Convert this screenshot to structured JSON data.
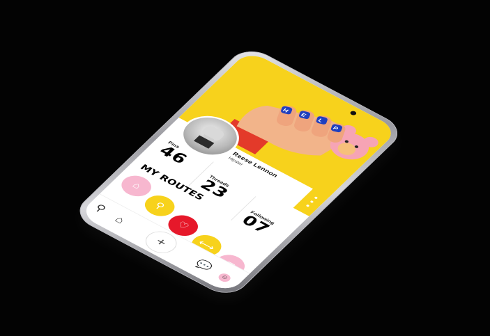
{
  "profile": {
    "name": "Reese Lennon",
    "handle": "Hipster"
  },
  "nail_letters": [
    "H",
    "E",
    "L",
    "P"
  ],
  "stats": {
    "pins": {
      "label": "Pins",
      "value": "46"
    },
    "threads": {
      "label": "Threads",
      "value": "23"
    },
    "following": {
      "label": "Following",
      "value": "07"
    }
  },
  "routes": {
    "title": "MY ROUTES",
    "items": [
      {
        "icon": "home-icon",
        "glyph": "⌂",
        "color": "#f7b7cf"
      },
      {
        "icon": "bike-icon",
        "glyph": "⚲",
        "color": "#f7d21c"
      },
      {
        "icon": "heart-icon",
        "glyph": "♡",
        "color": "#e6182a"
      },
      {
        "icon": "dumbbell-icon",
        "glyph": "⟷",
        "color": "#f7d21c"
      },
      {
        "icon": "bag-icon",
        "glyph": "▢",
        "color": "#f7b7cf"
      }
    ]
  },
  "nav": {
    "pin_glyph": "⚲",
    "home_glyph": "⌂",
    "plus_glyph": "+",
    "chat_glyph": "💬",
    "emoji_glyph": "☺"
  },
  "colors": {
    "accent_yellow": "#f7d21c",
    "accent_pink": "#f7b7cf",
    "accent_red": "#e6182a",
    "nail_blue": "#1f3fbf"
  }
}
